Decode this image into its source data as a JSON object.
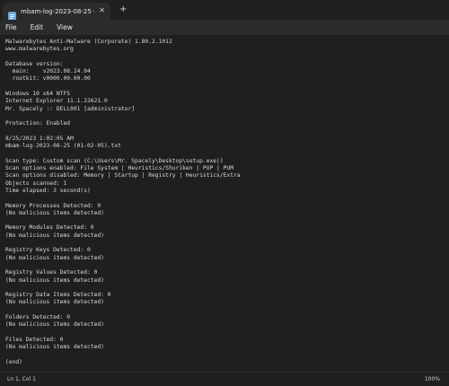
{
  "tab": {
    "title": "mbam-log-2023-08-25 (01-02-",
    "close_glyph": "✕",
    "new_tab_glyph": "+",
    "icon": "notepad-file-icon"
  },
  "menu": {
    "items": [
      "File",
      "Edit",
      "View"
    ]
  },
  "document": {
    "text": "Malwarebytes Anti-Malware (Corporate) 1.80.2.1012\nwww.malwarebytes.org\n\nDatabase version:\n  main:    v2023.08.24.04\n  rootkit: v0000.00.00.00\n\nWindows 10 x64 NTFS\nInternet Explorer 11.1.22621.0\nMr. Spacely :: DELL001 [administrator]\n\nProtection: Enabled\n\n8/25/2023 1:02:05 AM\nmbam-log-2023-08-25 (01-02-05).txt\n\nScan type: Custom scan (C:\\Users\\Mr. Spacely\\Desktop\\setup.exe|)\nScan options enabled: File System | Heuristics/Shuriken | PUP | PUM\nScan options disabled: Memory | Startup | Registry | Heuristics/Extra\nObjects scanned: 1\nTime elapsed: 3 second(s)\n\nMemory Processes Detected: 0\n(No malicious items detected)\n\nMemory Modules Detected: 0\n(No malicious items detected)\n\nRegistry Keys Detected: 0\n(No malicious items detected)\n\nRegistry Values Detected: 0\n(No malicious items detected)\n\nRegistry Data Items Detected: 0\n(No malicious items detected)\n\nFolders Detected: 0\n(No malicious items detected)\n\nFiles Detected: 0\n(No malicious items detected)\n\n(end)"
  },
  "status": {
    "position": "Ln 1, Col 1",
    "zoom": "100%"
  },
  "colors": {
    "background": "#1f1f1f",
    "menubar": "#2b2b2b",
    "text": "#d8d8d8"
  }
}
